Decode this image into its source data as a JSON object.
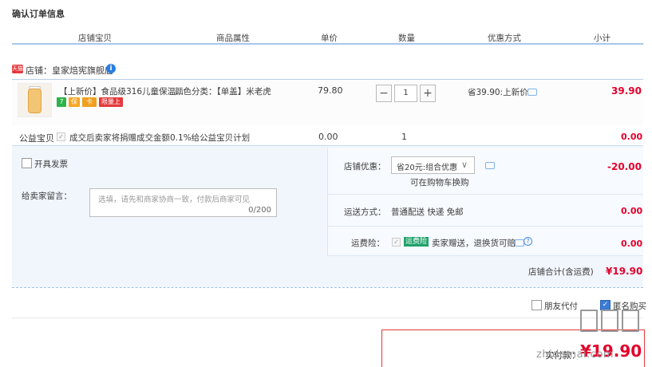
{
  "page_title": "确认订单信息",
  "columns": [
    "店铺宝贝",
    "商品属性",
    "单价",
    "数量",
    "优惠方式",
    "小计"
  ],
  "shop": {
    "badge": "天猫",
    "label": "店铺：皇家焙宪旗舰店",
    "info_icon": "i"
  },
  "item": {
    "name": "【上新价】食品级316儿童保温...",
    "attributes": "颜色分类：【单盖】米老虎",
    "unit_price": "79.80",
    "quantity": "1",
    "minus": "−",
    "plus": "+",
    "discount": "省39.90:上新价",
    "subtotal": "39.90",
    "tags": [
      "7",
      "保",
      "卡",
      "限量上新"
    ]
  },
  "charity": {
    "label": "公益宝贝",
    "check": "✓",
    "text": "成交后卖家将捐赠成交金额0.1%给公益宝贝计划",
    "price": "0.00",
    "qty": "1",
    "subtotal": "0.00"
  },
  "invoice": {
    "label": "开具发票"
  },
  "message": {
    "label": "给卖家留言：",
    "placeholder": "选填，请先和商家协商一致，付款后商家可见",
    "counter": "0/200"
  },
  "shop_discount": {
    "label": "店铺优惠：",
    "selected": "省20元:组合优惠",
    "caret": "∨",
    "note": "可在购物车换购",
    "amount": "-20.00"
  },
  "shipping": {
    "label": "运送方式：",
    "value": "普通配送 快递 免邮",
    "amount": "0.00"
  },
  "insurance": {
    "label": "运费险：",
    "check": "✓",
    "tag": "运费险",
    "text": "卖家赠送，退换货可赔",
    "help": "?",
    "amount": "0.00"
  },
  "shop_total": {
    "label": "店铺合计(含运费)",
    "amount": "¥19.90"
  },
  "options": {
    "anonymous_pay": "朋友代付",
    "anonymous_buy": "匿名购买",
    "check": "✓"
  },
  "footer": {
    "pay_label": "实付款：",
    "amount": "¥19.90",
    "watermark_text": "zhidemai.com"
  },
  "colors": {
    "accent_red": "#e4002b",
    "header_line": "#a8c6ea",
    "panel_bg": "#f1f6fd"
  }
}
